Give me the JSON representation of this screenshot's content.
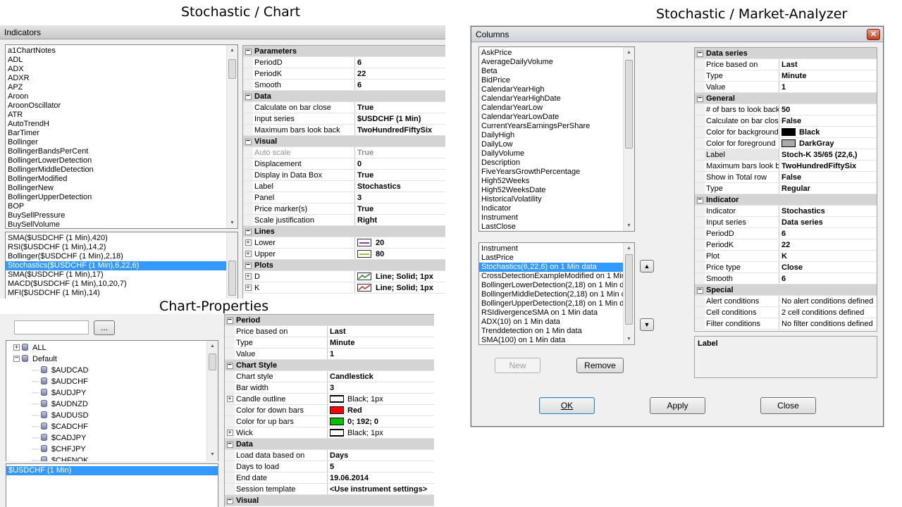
{
  "captions": {
    "chart": "Stochastic / Chart",
    "market_analyzer": "Stochastic / Market-Analyzer",
    "chart_properties": "Chart-Properties"
  },
  "indicators_window": {
    "title": "Indicators",
    "available": [
      "a1ChartNotes",
      "ADL",
      "ADX",
      "ADXR",
      "APZ",
      "Aroon",
      "AroonOscillator",
      "ATR",
      "AutoTrendH",
      "BarTimer",
      "Bollinger",
      "BollingerBandsPerCent",
      "BollingerLowerDetection",
      "BollingerMiddleDetection",
      "BollingerModified",
      "BollingerNew",
      "BollingerUpperDetection",
      "BOP",
      "BuySellPressure",
      "BuySellVolume"
    ],
    "applied": [
      "SMA($USDCHF (1 Min),420)",
      "RSI($USDCHF (1 Min),14,2)",
      "Bollinger($USDCHF (1 Min),2,18)",
      "Stochastics($USDCHF (1 Min),6,22,6)",
      "SMA($USDCHF (1 Min),17)",
      "MACD($USDCHF (1 Min),10,20,7)",
      "MFI($USDCHF (1 Min),14)"
    ],
    "applied_selected": 3,
    "properties": [
      {
        "type": "cat",
        "name": "Parameters"
      },
      {
        "name": "PeriodD",
        "value": "6"
      },
      {
        "name": "PeriodK",
        "value": "22"
      },
      {
        "name": "Smooth",
        "value": "6"
      },
      {
        "type": "cat",
        "name": "Data"
      },
      {
        "name": "Calculate on bar close",
        "value": "True"
      },
      {
        "name": "Input series",
        "value": "$USDCHF (1 Min)"
      },
      {
        "name": "Maximum bars look back",
        "value": "TwoHundredFiftySix"
      },
      {
        "type": "cat",
        "name": "Visual"
      },
      {
        "name": "Auto scale",
        "value": "True",
        "disabled": true
      },
      {
        "name": "Displacement",
        "value": "0"
      },
      {
        "name": "Display in Data Box",
        "value": "True"
      },
      {
        "name": "Label",
        "value": "Stochastics"
      },
      {
        "name": "Panel",
        "value": "3"
      },
      {
        "name": "Price marker(s)",
        "value": "True"
      },
      {
        "name": "Scale justification",
        "value": "Right"
      },
      {
        "type": "cat",
        "name": "Lines"
      },
      {
        "name": "Lower",
        "value": "20",
        "expand": true,
        "line": "#8040c0"
      },
      {
        "name": "Upper",
        "value": "80",
        "expand": true,
        "line": "#a0c040"
      },
      {
        "type": "cat",
        "name": "Plots"
      },
      {
        "name": "D",
        "value": "Line; Solid; 1px",
        "expand": true,
        "plot": "#208020"
      },
      {
        "name": "K",
        "value": "Line; Solid; 1px",
        "expand": true,
        "plot": "#d02020"
      }
    ]
  },
  "chart_properties": {
    "search_button": "...",
    "tree": [
      {
        "label": "ALL",
        "level": 0,
        "expander": "+"
      },
      {
        "label": "Default",
        "level": 0,
        "expander": "-"
      },
      {
        "label": "$AUDCAD",
        "level": 1
      },
      {
        "label": "$AUDCHF",
        "level": 1
      },
      {
        "label": "$AUDJPY",
        "level": 1
      },
      {
        "label": "$AUDNZD",
        "level": 1
      },
      {
        "label": "$AUDUSD",
        "level": 1
      },
      {
        "label": "$CADCHF",
        "level": 1
      },
      {
        "label": "$CADJPY",
        "level": 1
      },
      {
        "label": "$CHFJPY",
        "level": 1
      },
      {
        "label": "$CHFNOK",
        "level": 1
      }
    ],
    "selected_instrument": "$USDCHF (1 Min)",
    "properties": [
      {
        "type": "cat",
        "name": "Period"
      },
      {
        "name": "Price based on",
        "value": "Last"
      },
      {
        "name": "Type",
        "value": "Minute"
      },
      {
        "name": "Value",
        "value": "1"
      },
      {
        "type": "cat",
        "name": "Chart Style"
      },
      {
        "name": "Chart style",
        "value": "Candlestick"
      },
      {
        "name": "Bar width",
        "value": "3"
      },
      {
        "name": "Candle outline",
        "value": "Black; 1px",
        "expand": true,
        "lineswatch": "#000000",
        "normal": true
      },
      {
        "name": "Color for down bars",
        "value": "Red",
        "swatch": "#ff0000"
      },
      {
        "name": "Color for up bars",
        "value": "0; 192; 0",
        "swatch": "#00c000"
      },
      {
        "name": "Wick",
        "value": "Black; 1px",
        "expand": true,
        "lineswatch": "#000000",
        "normal": true
      },
      {
        "type": "cat",
        "name": "Data"
      },
      {
        "name": "Load data based on",
        "value": "Days"
      },
      {
        "name": "Days to load",
        "value": "5"
      },
      {
        "name": "End date",
        "value": "19.06.2014"
      },
      {
        "name": "Session template",
        "value": "<Use instrument settings>"
      },
      {
        "type": "cat",
        "name": "Visual"
      }
    ]
  },
  "columns_window": {
    "title": "Columns",
    "available": [
      "AskPrice",
      "AverageDailyVolume",
      "Beta",
      "BidPrice",
      "CalendarYearHigh",
      "CalendarYearHighDate",
      "CalendarYearLow",
      "CalendarYearLowDate",
      "CurrentYearsEarningsPerShare",
      "DailyHigh",
      "DailyLow",
      "DailyVolume",
      "Description",
      "FiveYearsGrowthPercentage",
      "High52Weeks",
      "High52WeeksDate",
      "HistoricalVolatility",
      "Indicator",
      "Instrument",
      "LastClose"
    ],
    "selected": [
      "Instrument",
      "LastPrice",
      "Stochastics(6,22,6) on 1 Min data",
      "CrossDetectionExampleModified on 1 Min",
      "BollingerLowerDetection(2,18) on 1 Min data",
      "BollingerMiddleDetection(2,18) on 1 Min data",
      "BollingerUpperDetection(2,18) on 1 Min data",
      "RSIdivergenceSMA on 1 Min data",
      "ADX(10) on 1 Min data",
      "Trenddetection on 1 Min data",
      "SMA(100) on 1 Min data"
    ],
    "selected_index": 2,
    "buttons": {
      "new": "New",
      "remove": "Remove",
      "ok": "OK",
      "apply": "Apply",
      "close": "Close"
    },
    "properties": [
      {
        "type": "cat",
        "name": "Data series"
      },
      {
        "name": "Price based on",
        "value": "Last"
      },
      {
        "name": "Type",
        "value": "Minute"
      },
      {
        "name": "Value",
        "value": "1"
      },
      {
        "type": "cat",
        "name": "General"
      },
      {
        "name": "# of bars to look back",
        "value": "50"
      },
      {
        "name": "Calculate on bar close",
        "value": "False"
      },
      {
        "name": "Color for background",
        "value": "Black",
        "swatch": "#000000"
      },
      {
        "name": "Color for foreground",
        "value": "DarkGray",
        "swatch": "#a9a9a9"
      },
      {
        "name": "Label",
        "value": "Stoch-K 35/65  (22,6,)",
        "highlight": true
      },
      {
        "name": "Maximum bars look back",
        "value": "TwoHundredFiftySix"
      },
      {
        "name": "Show in Total row",
        "value": "False"
      },
      {
        "name": "Type",
        "value": "Regular"
      },
      {
        "type": "cat",
        "name": "Indicator"
      },
      {
        "name": "Indicator",
        "value": "Stochastics"
      },
      {
        "name": "Input series",
        "value": "Data series"
      },
      {
        "name": "PeriodD",
        "value": "6"
      },
      {
        "name": "PeriodK",
        "value": "22"
      },
      {
        "name": "Plot",
        "value": "K"
      },
      {
        "name": "Price type",
        "value": "Close"
      },
      {
        "name": "Smooth",
        "value": "6"
      },
      {
        "type": "cat",
        "name": "Special"
      },
      {
        "name": "Alert conditions",
        "value": "No alert conditions defined",
        "normal": true
      },
      {
        "name": "Cell conditions",
        "value": "2 cell conditions defined",
        "normal": true
      },
      {
        "name": "Filter conditions",
        "value": "No filter conditions defined",
        "normal": true
      }
    ],
    "description_title": "Label"
  }
}
